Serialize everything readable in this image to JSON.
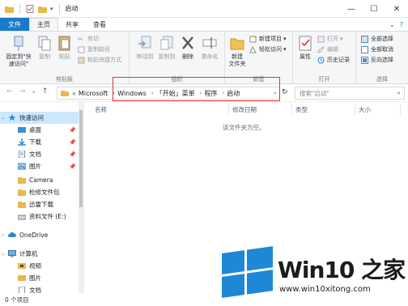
{
  "window": {
    "title": "启动",
    "controls": {
      "minimize": "—",
      "maximize": "☐",
      "close": "✕"
    }
  },
  "ribbon_tabs": [
    "文件",
    "主页",
    "共享",
    "查看"
  ],
  "ribbon": {
    "clipboard": {
      "label": "剪贴板",
      "pin": "固定到\"快速访问\"",
      "copy": "复制",
      "paste": "粘贴",
      "cut": "剪切",
      "copy_path": "复制路径",
      "paste_shortcut": "粘贴快捷方式"
    },
    "organize": {
      "label": "组织",
      "move_to": "移动到",
      "copy_to": "复制到",
      "delete": "删除",
      "rename": "重命名"
    },
    "new": {
      "label": "新建",
      "new_folder": "新建\n文件夹",
      "new_item": "新建项目",
      "easy_access": "轻松访问"
    },
    "open": {
      "label": "打开",
      "properties": "属性",
      "open": "打开",
      "edit": "编辑",
      "history": "历史记录"
    },
    "select": {
      "label": "选择",
      "select_all": "全部选择",
      "select_none": "全部取消",
      "invert": "反向选择"
    }
  },
  "address": {
    "crumbs": [
      "«",
      "Microsoft",
      "Windows",
      "「开始」菜单",
      "程序",
      "启动"
    ],
    "search_placeholder": "搜索\"启动\""
  },
  "columns": {
    "name": "名称",
    "date": "修改日期",
    "type": "类型",
    "size": "大小"
  },
  "empty_message": "该文件夹为空。",
  "navpane": {
    "quick_access": "快速访问",
    "items": [
      {
        "label": "桌面",
        "pinned": true
      },
      {
        "label": "下载",
        "pinned": true
      },
      {
        "label": "文档",
        "pinned": true
      },
      {
        "label": "图片",
        "pinned": true
      },
      {
        "label": "Camera",
        "pinned": false
      },
      {
        "label": "检修文件包",
        "pinned": false
      },
      {
        "label": "迅雷下载",
        "pinned": false
      },
      {
        "label": "资料文件 (E:)",
        "pinned": false
      }
    ],
    "onedrive": "OneDrive",
    "this_pc": "计算机",
    "pc_items": [
      "视频",
      "图片",
      "文档"
    ]
  },
  "status": {
    "count": "0 个项目"
  },
  "watermark": {
    "brand": "Win10 之家",
    "url": "www.win10xitong.com"
  },
  "colors": {
    "accent": "#1979ca",
    "highlight_box": "#e23333",
    "logo_blue": "#1e88d6"
  }
}
